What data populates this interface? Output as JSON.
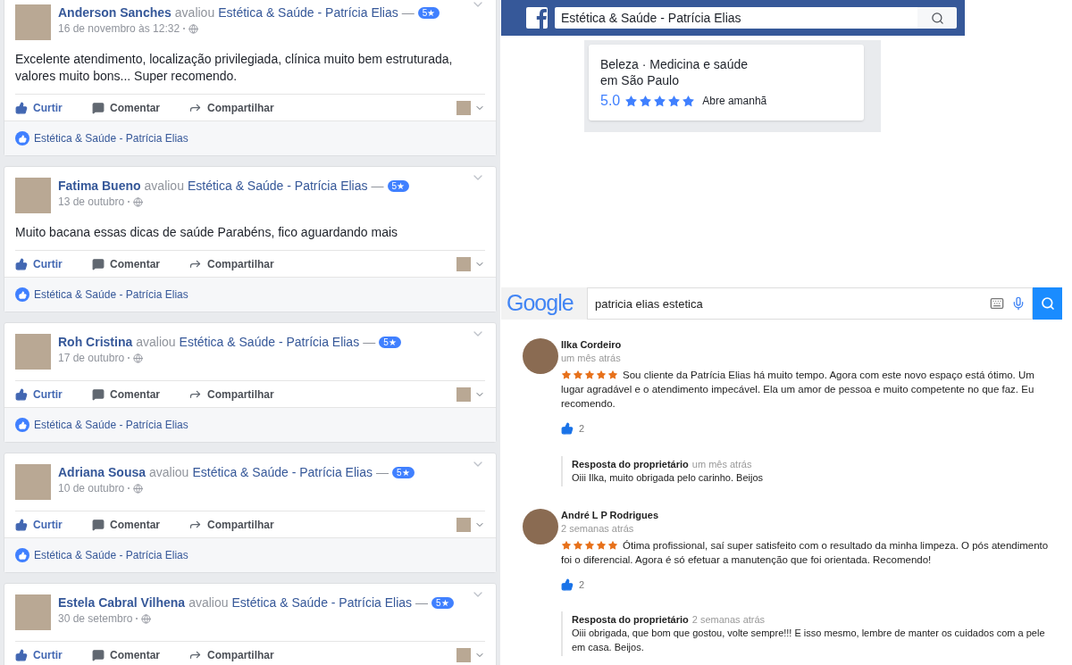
{
  "facebook_reviews": [
    {
      "name": "Anderson Sanches",
      "verb": "avaliou",
      "page": "Estética & Saúde - Patrícia Elias",
      "dash": "—",
      "rating_badge": "5★",
      "date": "16 de novembro às 12:32",
      "text": "Excelente atendimento, localização privilegiada, clínica muito bem estruturada, valores muito bons... Super recomendo.",
      "actions": {
        "like": "Curtir",
        "liked": true,
        "comment": "Comentar",
        "share": "Compartilhar"
      },
      "liked_by": "Estética & Saúde - Patrícia Elias"
    },
    {
      "name": "Fatima Bueno",
      "verb": "avaliou",
      "page": "Estética & Saúde - Patrícia Elias",
      "dash": "—",
      "rating_badge": "5★",
      "date": "13 de outubro",
      "text": "Muito bacana essas dicas de saúde Parabéns, fico aguardando mais",
      "actions": {
        "like": "Curtir",
        "liked": true,
        "comment": "Comentar",
        "share": "Compartilhar"
      },
      "liked_by": "Estética & Saúde - Patrícia Elias"
    },
    {
      "name": "Roh Cristina",
      "verb": "avaliou",
      "page": "Estética & Saúde - Patrícia Elias",
      "dash": "—",
      "rating_badge": "5★",
      "date": "17 de outubro",
      "actions": {
        "like": "Curtir",
        "liked": true,
        "comment": "Comentar",
        "share": "Compartilhar"
      },
      "liked_by": "Estética & Saúde - Patrícia Elias"
    },
    {
      "name": "Adriana Sousa",
      "verb": "avaliou",
      "page": "Estética & Saúde - Patrícia Elias",
      "dash": "—",
      "rating_badge": "5★",
      "date": "10 de outubro",
      "actions": {
        "like": "Curtir",
        "liked": true,
        "comment": "Comentar",
        "share": "Compartilhar"
      },
      "liked_by": "Estética & Saúde - Patrícia Elias"
    },
    {
      "name": "Estela Cabral Vilhena",
      "verb": "avaliou",
      "page": "Estética & Saúde - Patrícia Elias",
      "dash": "—",
      "rating_badge": "5★",
      "date": "30 de setembro",
      "actions": {
        "like": "Curtir",
        "liked": true,
        "comment": "Comentar",
        "share": "Compartilhar"
      }
    }
  ],
  "facebook_search": {
    "value": "Estética & Saúde - Patrícia Elias"
  },
  "page_summary": {
    "category": "Beleza · Medicina e saúde",
    "location": "em São Paulo",
    "rating": "5.0",
    "stars": 5,
    "hours": "Abre amanhã"
  },
  "google_search": {
    "logo": "Google",
    "value": "patricia elias estetica"
  },
  "google_reviews": [
    {
      "name": "Ilka Cordeiro",
      "time": "um mês atrás",
      "stars": 5,
      "text": "Sou cliente da Patrícia Elias há muito tempo. Agora  com este novo espaço está ótimo. Um lugar agradável e o atendimento impecável. Ela um amor de pessoa e muito competente no que faz. Eu recomendo.",
      "likes": "2",
      "reply": {
        "label": "Resposta do proprietário",
        "time": "um mês atrás",
        "text": "Oiii Ilka, muito obrigada pelo carinho. Beijos"
      }
    },
    {
      "name": "André L P Rodrigues",
      "time": "2 semanas atrás",
      "stars": 5,
      "text": "Ótima profissional, saí super satisfeito com o resultado da minha limpeza. O pós atendimento foi o diferencial. Agora é só efetuar a manutenção que foi orientada. Recomendo!",
      "likes": "2",
      "reply": {
        "label": "Resposta do proprietário",
        "time": "2 semanas atrás",
        "text": "Oiii obrigada, que bom que gostou, volte sempre!!! E isso mesmo, lembre de manter os cuidados com a pele em casa. Beijos."
      }
    }
  ]
}
